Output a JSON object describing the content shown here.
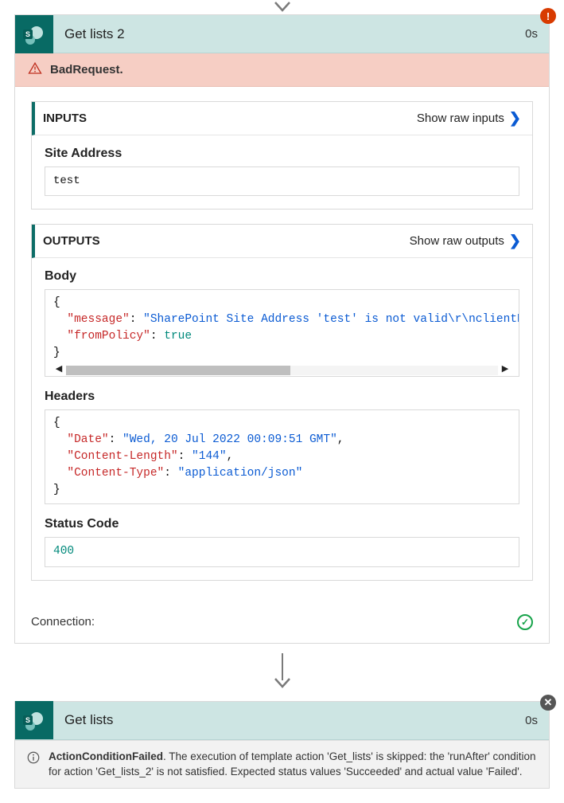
{
  "card1": {
    "title": "Get lists 2",
    "duration": "0s",
    "badge": "!",
    "error_text": "BadRequest.",
    "inputs": {
      "header": "INPUTS",
      "raw_link": "Show raw inputs",
      "site_address_label": "Site Address",
      "site_address_value": "test"
    },
    "outputs": {
      "header": "OUTPUTS",
      "raw_link": "Show raw outputs",
      "body_label": "Body",
      "body_json": {
        "k_message": "\"message\"",
        "v_message": "\"SharePoint Site Address 'test' is not valid\\r\\nclientReque",
        "k_fromPolicy": "\"fromPolicy\"",
        "v_fromPolicy": "true"
      },
      "headers_label": "Headers",
      "headers_json": {
        "k_date": "\"Date\"",
        "v_date": "\"Wed, 20 Jul 2022 00:09:51 GMT\"",
        "k_clen": "\"Content-Length\"",
        "v_clen": "\"144\"",
        "k_ctype": "\"Content-Type\"",
        "v_ctype": "\"application/json\""
      },
      "status_label": "Status Code",
      "status_value": "400"
    },
    "connection_label": "Connection:"
  },
  "card2": {
    "title": "Get lists",
    "duration": "0s",
    "badge": "✕",
    "info_title": "ActionConditionFailed",
    "info_text": ". The execution of template action 'Get_lists' is skipped: the 'runAfter' condition for action 'Get_lists_2' is not satisfied. Expected status values 'Succeeded' and actual value 'Failed'."
  }
}
